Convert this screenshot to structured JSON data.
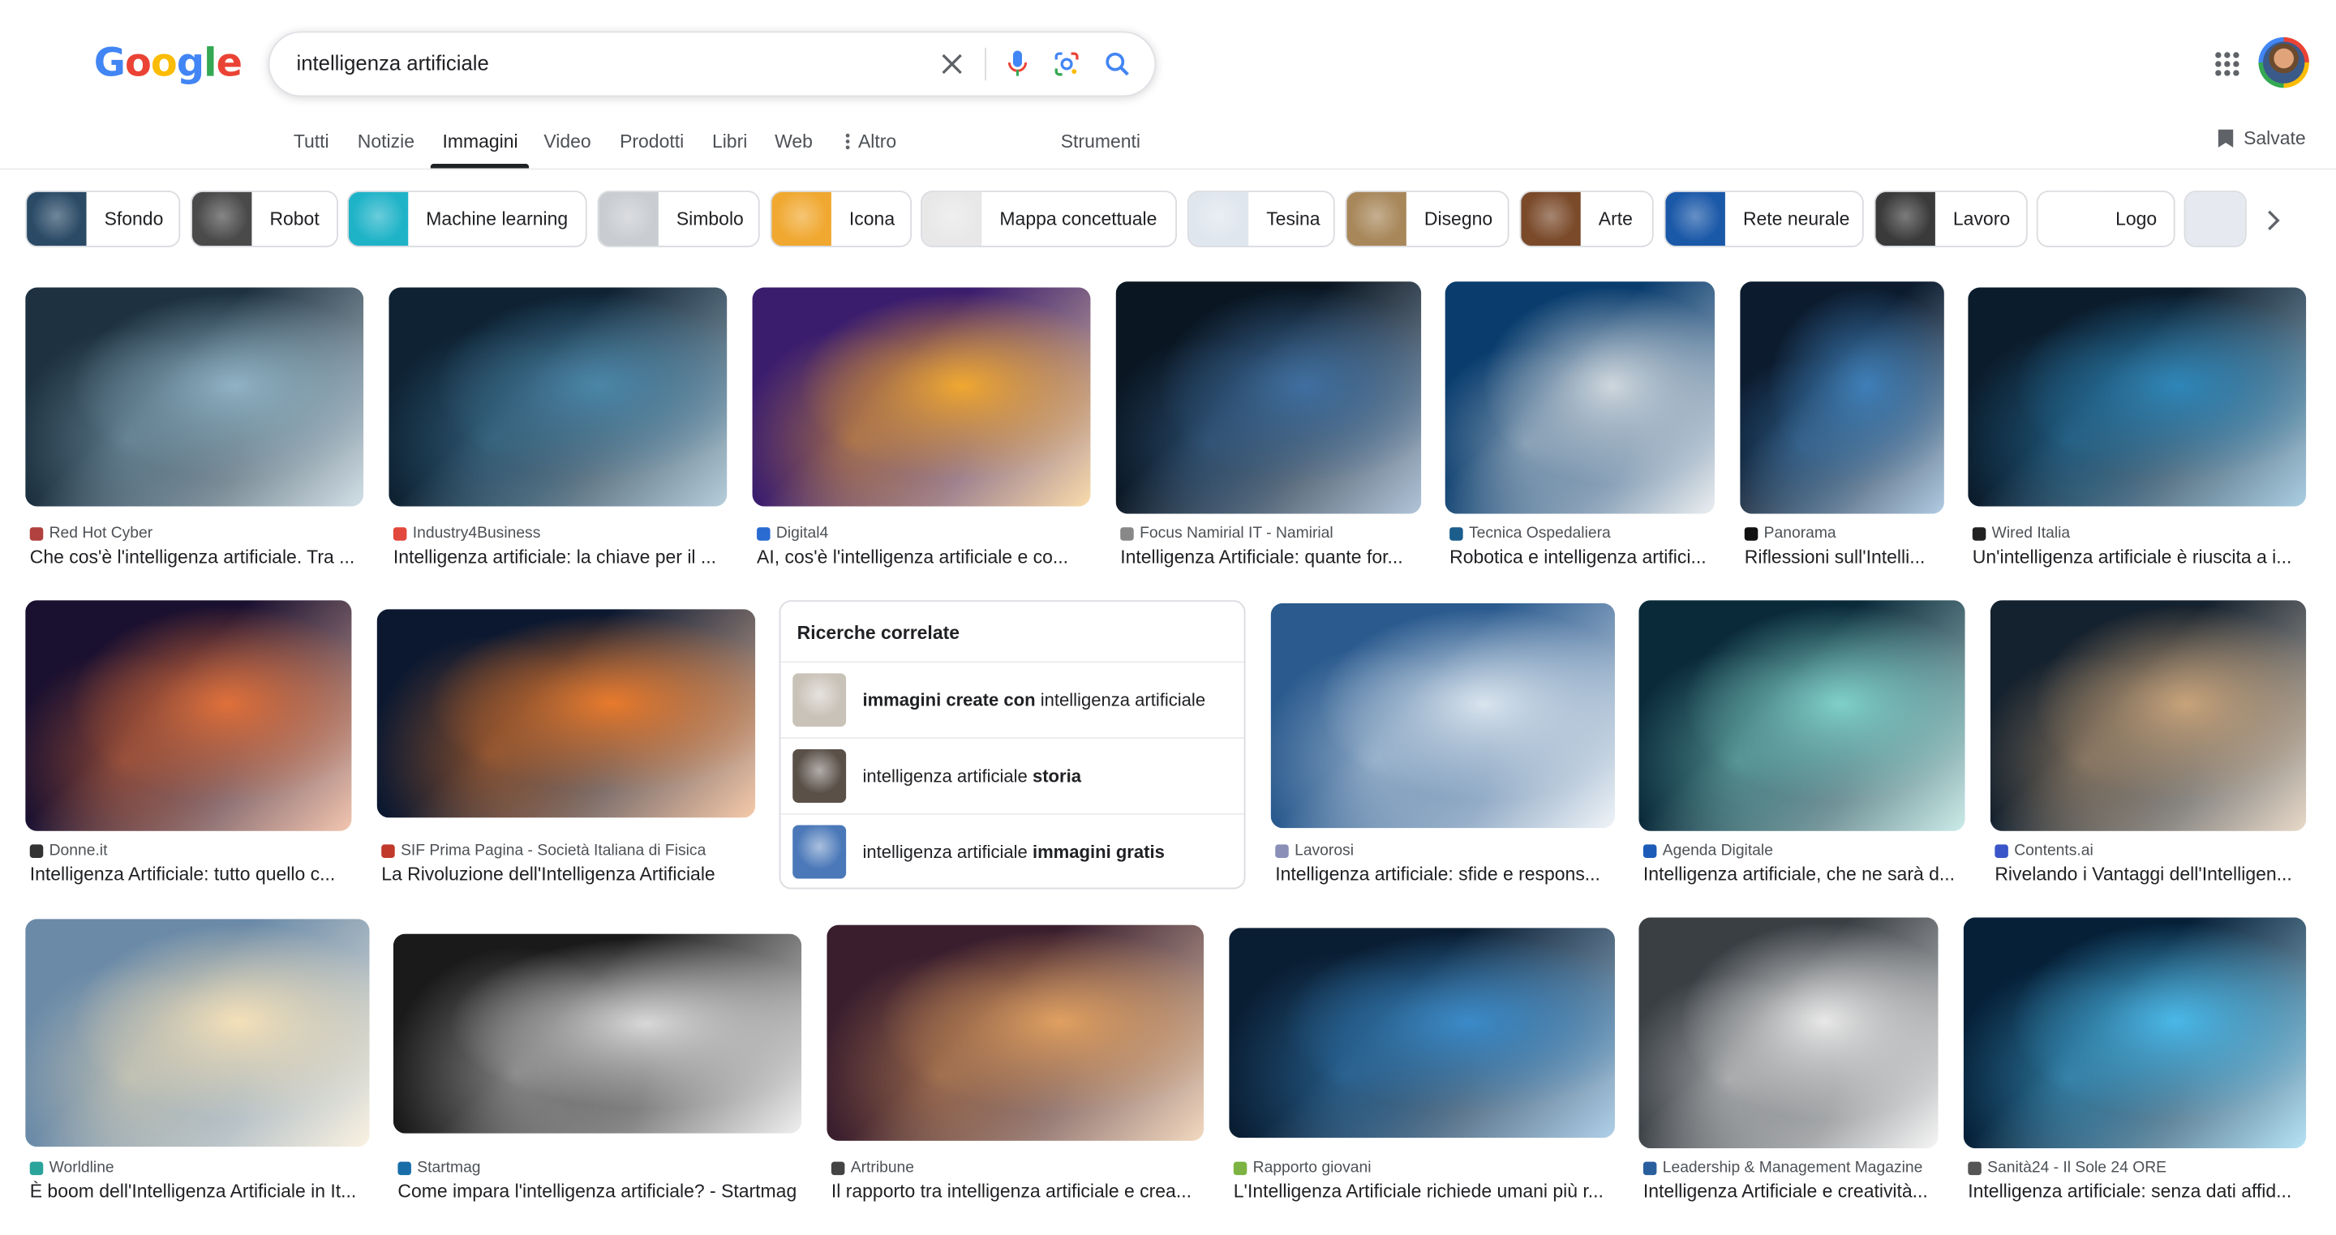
{
  "header": {
    "logo_letters": [
      {
        "ch": "G",
        "color": "#4285f4"
      },
      {
        "ch": "o",
        "color": "#ea4335"
      },
      {
        "ch": "o",
        "color": "#fbbc05"
      },
      {
        "ch": "g",
        "color": "#4285f4"
      },
      {
        "ch": "l",
        "color": "#34a853"
      },
      {
        "ch": "e",
        "color": "#ea4335"
      }
    ],
    "query": "intelligenza artificiale"
  },
  "tabs": {
    "items": [
      "Tutti",
      "Notizie",
      "Immagini",
      "Video",
      "Prodotti",
      "Libri",
      "Web"
    ],
    "more": "Altro",
    "tools": "Strumenti",
    "active": "Immagini"
  },
  "saved_label": "Salvate",
  "chips": [
    {
      "label": "Sfondo",
      "color": "#2a4a66"
    },
    {
      "label": "Robot",
      "color": "#4a4a4a"
    },
    {
      "label": "Machine learning",
      "color": "#1fb3c8"
    },
    {
      "label": "Simbolo",
      "color": "#c9ccd1"
    },
    {
      "label": "Icona",
      "color": "#f0a830"
    },
    {
      "label": "Mappa concettuale",
      "color": "#e8e8e8"
    },
    {
      "label": "Tesina",
      "color": "#dfe6ee"
    },
    {
      "label": "Disegno",
      "color": "#a8875a"
    },
    {
      "label": "Arte",
      "color": "#7a4a2a"
    },
    {
      "label": "Rete neurale",
      "color": "#1a58a8"
    },
    {
      "label": "Lavoro",
      "color": "#3a3a3a"
    },
    {
      "label": "Logo",
      "color": "#ffffff"
    }
  ],
  "results": [
    {
      "source": "Red Hot Cyber",
      "title": "Che cos'è l'intelligenza artificiale. Tra ...",
      "fav": "#b0413e",
      "c1": "#1d3140",
      "c2": "#8fb2c4"
    },
    {
      "source": "Industry4Business",
      "title": "Intelligenza artificiale: la chiave per il ...",
      "fav": "#e2483d",
      "c1": "#0e2233",
      "c2": "#4a86a8"
    },
    {
      "source": "Digital4",
      "title": "AI, cos'è l'intelligenza artificiale e co...",
      "fav": "#2a6bd1",
      "c1": "#3b1d6e",
      "c2": "#f0a830"
    },
    {
      "source": "Focus Namirial IT - Namirial",
      "title": "Intelligenza Artificiale: quante for...",
      "fav": "#888888",
      "c1": "#0a1622",
      "c2": "#3f6fa0"
    },
    {
      "source": "Tecnica Ospedaliera",
      "title": "Robotica e intelligenza artifici...",
      "fav": "#1b5e8c",
      "c1": "#0a3d6e",
      "c2": "#cfd7dd"
    },
    {
      "source": "Panorama",
      "title": "Riflessioni sull'Intelli...",
      "fav": "#111111",
      "c1": "#0c1b2e",
      "c2": "#3e7fb8"
    },
    {
      "source": "Wired Italia",
      "title": "Un'intelligenza artificiale è riuscita a i...",
      "fav": "#222222",
      "c1": "#0b1c2c",
      "c2": "#2e86b8"
    },
    {
      "source": "Donne.it",
      "title": "Intelligenza Artificiale: tutto quello c...",
      "fav": "#333333",
      "c1": "#1a1030",
      "c2": "#e0703a"
    },
    {
      "source": "SIF Prima Pagina - Società Italiana di Fisica",
      "title": "La Rivoluzione dell'Intelligenza Artificiale",
      "fav": "#c0392b",
      "c1": "#0b1830",
      "c2": "#e87a2c"
    },
    {
      "source": "Lavorosi",
      "title": "Intelligenza artificiale: sfide e respons...",
      "fav": "#8a8fb8",
      "c1": "#2a5a8e",
      "c2": "#d9e4ee"
    },
    {
      "source": "Agenda Digitale",
      "title": "Intelligenza artificiale, che ne sarà d...",
      "fav": "#1c5bb8",
      "c1": "#0a2a3a",
      "c2": "#7fd0c8"
    },
    {
      "source": "Contents.ai",
      "title": "Rivelando i Vantaggi dell'Intelligen...",
      "fav": "#3a55c8",
      "c1": "#14212e",
      "c2": "#c8a37a"
    },
    {
      "source": "Worldline",
      "title": "È boom dell'Intelligenza Artificiale in It...",
      "fav": "#2aa39b",
      "c1": "#6a8aa8",
      "c2": "#f4e0b8"
    },
    {
      "source": "Startmag",
      "title": "Come impara l'intelligenza artificiale? - Startmag",
      "fav": "#1a6ea8",
      "c1": "#1a1a1a",
      "c2": "#d8d8d8"
    },
    {
      "source": "Artribune",
      "title": "Il rapporto tra intelligenza artificiale e crea...",
      "fav": "#444444",
      "c1": "#3a1e2e",
      "c2": "#e0a060"
    },
    {
      "source": "Rapporto giovani",
      "title": "L'Intelligenza Artificiale richiede umani più r...",
      "fav": "#7cb342",
      "c1": "#0a1e33",
      "c2": "#3a8ac8"
    },
    {
      "source": "Leadership & Management Magazine",
      "title": "Intelligenza Artificiale e creatività...",
      "fav": "#2a5f9e",
      "c1": "#3a3f44",
      "c2": "#e8e8e8"
    },
    {
      "source": "Sanità24 - Il Sole 24 ORE",
      "title": "Intelligenza artificiale: senza dati affid...",
      "fav": "#555555",
      "c1": "#062038",
      "c2": "#4ab8e8"
    }
  ],
  "related": {
    "heading": "Ricerche correlate",
    "items": [
      {
        "bold_pre": "immagini create con",
        "plain_pre": "",
        "plain_post": " intelligenza artificiale",
        "bold_post": "",
        "thumb": "#c9c2b8"
      },
      {
        "bold_pre": "",
        "plain_pre": "intelligenza artificiale ",
        "plain_post": "",
        "bold_post": "storia",
        "thumb": "#5a5048"
      },
      {
        "bold_pre": "",
        "plain_pre": "intelligenza artificiale ",
        "plain_post": "",
        "bold_post": "immagini gratis",
        "thumb": "#4a78b8"
      }
    ]
  }
}
